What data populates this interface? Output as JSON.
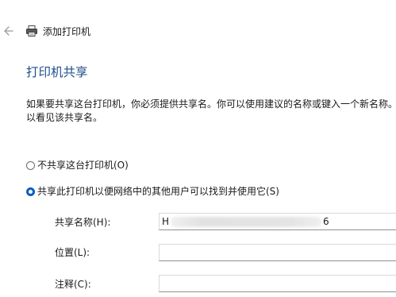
{
  "header": {
    "title": "添加打印机",
    "back_icon": "back-arrow-icon",
    "printer_icon": "printer-icon"
  },
  "page": {
    "heading": "打印机共享",
    "description": "如果要共享这台打印机，你必须提供共享名。你可以使用建议的名称或键入一个新名称。\n以看见该共享名。"
  },
  "options": {
    "no_share": {
      "label": "不共享这台打印机(O)",
      "selected": false
    },
    "share": {
      "label": "共享此打印机以便网络中的其他用户可以找到并使用它(S)",
      "selected": true
    }
  },
  "fields": {
    "share_name": {
      "label": "共享名称(H):",
      "value_start": "H",
      "value_end": "6"
    },
    "location": {
      "label": "位置(L):",
      "value": ""
    },
    "comment": {
      "label": "注释(C):",
      "value": ""
    }
  },
  "colors": {
    "heading": "#1f4e8c",
    "accent": "#0a5ec2"
  }
}
